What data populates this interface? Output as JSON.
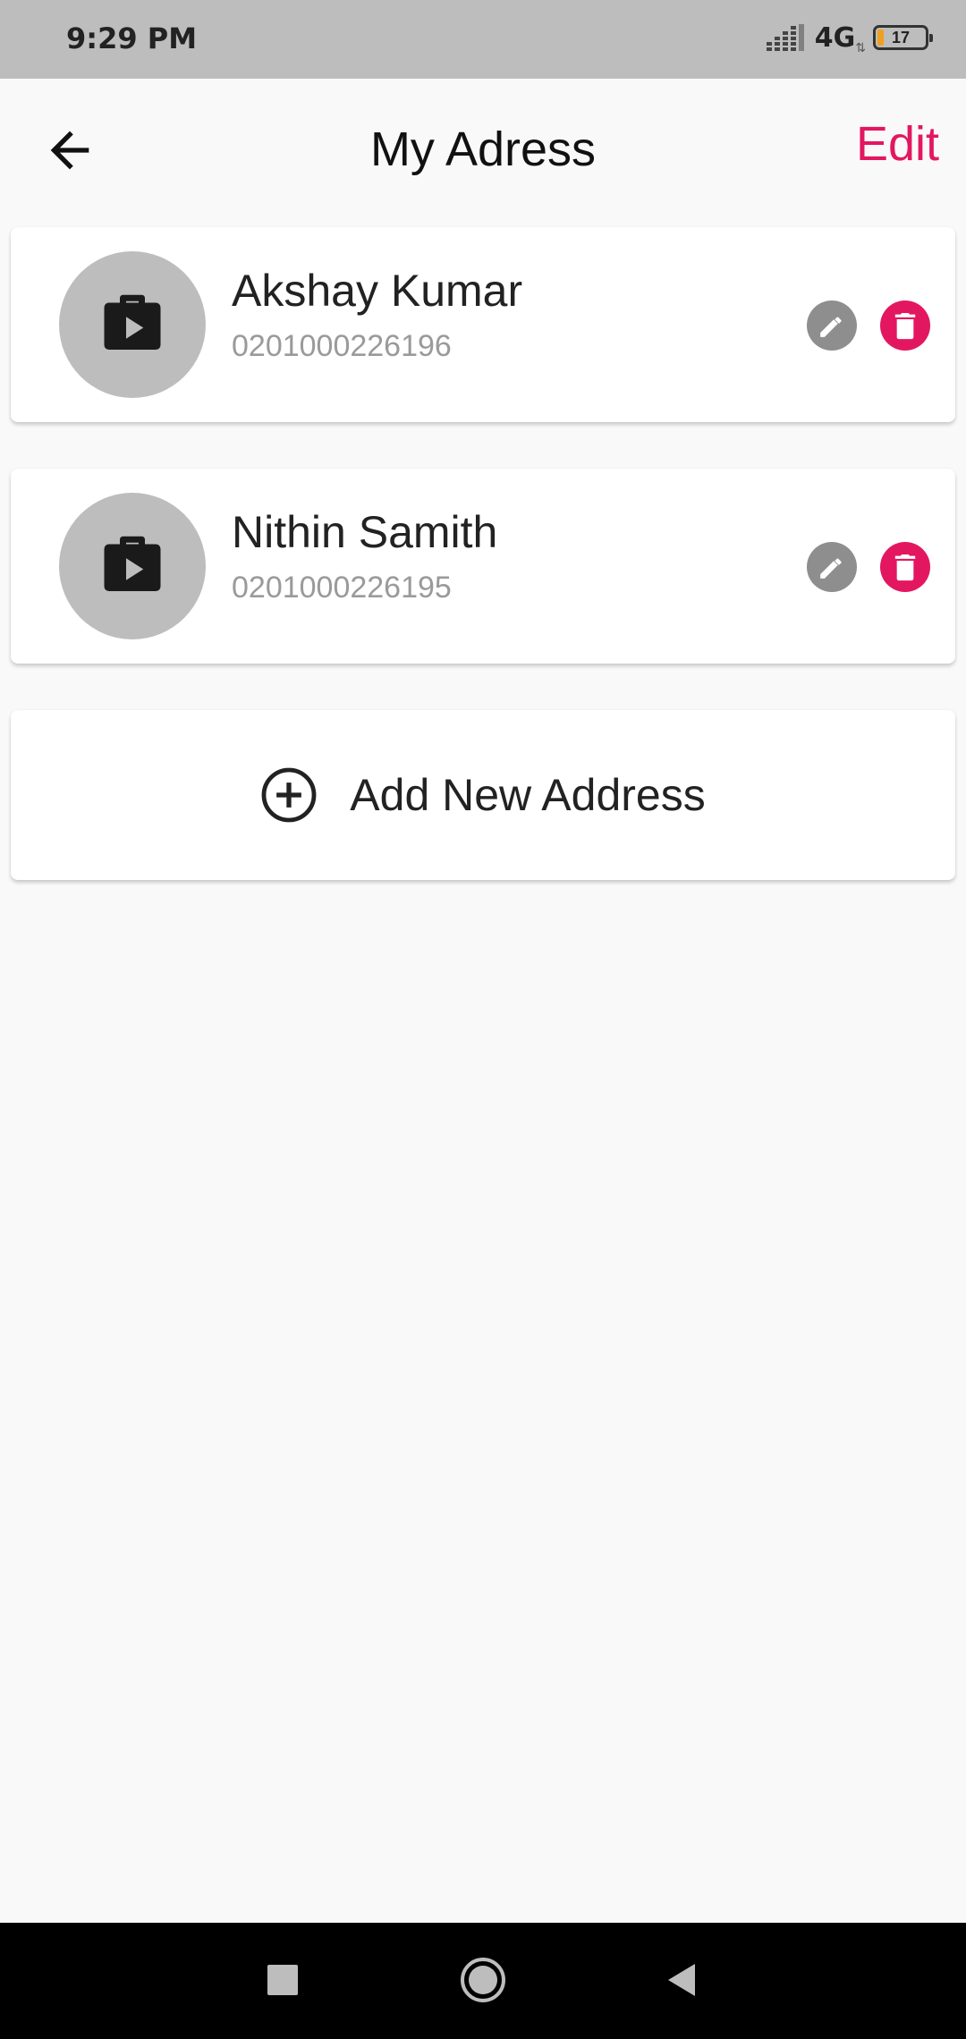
{
  "status_bar": {
    "time": "9:29 PM",
    "network": "4G",
    "battery": "17"
  },
  "header": {
    "title": "My Adress",
    "edit_label": "Edit",
    "back_icon": "arrow-left-icon"
  },
  "addresses": [
    {
      "name": "Akshay Kumar",
      "number": "0201000226196"
    },
    {
      "name": "Nithin Samith",
      "number": "0201000226195"
    }
  ],
  "add_address": {
    "label": "Add New Address",
    "icon": "add-circle-icon"
  },
  "colors": {
    "accent": "#e3175f",
    "avatar_bg": "#bdbdbd",
    "edit_icon": "#8e8e8e",
    "status_bar": "#bdbdbd",
    "background": "#f9f9f9"
  },
  "nav_bar": {
    "icons": [
      "recents-square-icon",
      "home-circle-icon",
      "back-triangle-icon"
    ]
  }
}
